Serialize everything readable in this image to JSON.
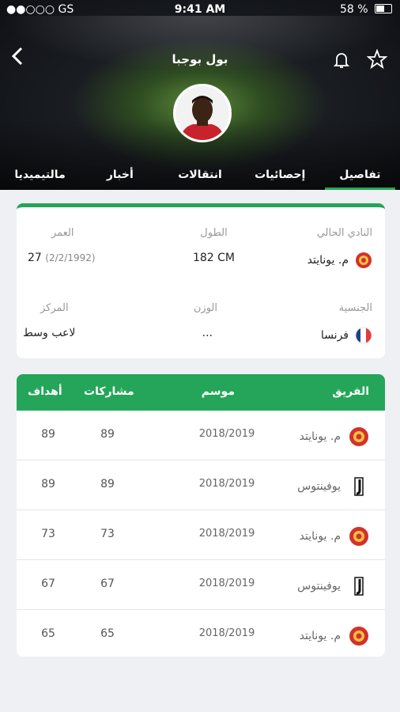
{
  "status": {
    "carrier": "●●○○○ GS",
    "time": "9:41 AM",
    "battery": "58 %"
  },
  "nav": {
    "title": "بول بوجبا"
  },
  "tabs": [
    "تفاصيل",
    "إحصائيات",
    "انتقالات",
    "أخبار",
    "مالتيميديا"
  ],
  "info": {
    "club_label": "النادي الحالي",
    "club_value": "م. يونايتد",
    "height_label": "الطول",
    "height_value": "182 CM",
    "age_label": "العمر",
    "age_value": "27",
    "age_date": "(2/2/1992)",
    "nationality_label": "الجنسية",
    "nationality_value": "فرنسا",
    "weight_label": "الوزن",
    "weight_value": "...",
    "position_label": "المركز",
    "position_value": "لاعب وسط"
  },
  "table": {
    "headers": {
      "team": "الفريق",
      "season": "موسم",
      "apps": "مشاركات",
      "goals": "أهداف"
    },
    "rows": [
      {
        "team": "م. يونايتد",
        "logo": "manutd-icon",
        "season": "2018/2019",
        "apps": "89",
        "goals": "89"
      },
      {
        "team": "يوفينتوس",
        "logo": "juventus-icon",
        "season": "2018/2019",
        "apps": "89",
        "goals": "89"
      },
      {
        "team": "م. يونايتد",
        "logo": "manutd-icon",
        "season": "2018/2019",
        "apps": "73",
        "goals": "73"
      },
      {
        "team": "يوفينتوس",
        "logo": "juventus-icon",
        "season": "2018/2019",
        "apps": "67",
        "goals": "67"
      },
      {
        "team": "م. يونايتد",
        "logo": "manutd-icon",
        "season": "2018/2019",
        "apps": "65",
        "goals": "65"
      }
    ]
  },
  "colors": {
    "accent": "#25a55a",
    "manutd": "#d4312a",
    "france_blue": "#1f3f8f",
    "france_red": "#e23a3a"
  }
}
